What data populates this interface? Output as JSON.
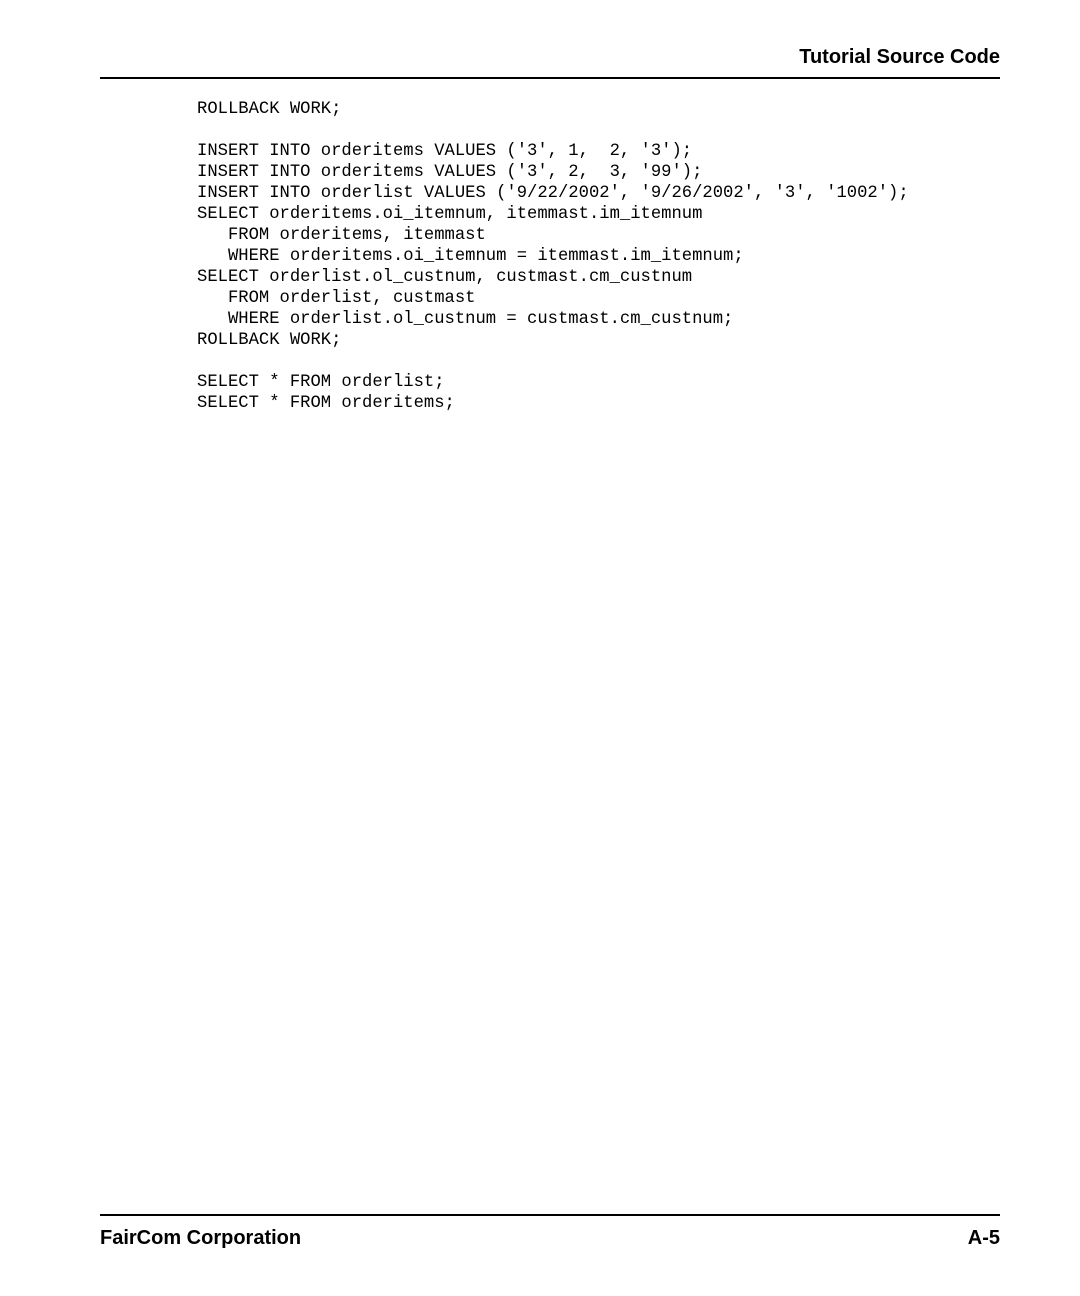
{
  "header": {
    "title": "Tutorial Source Code"
  },
  "code": {
    "text": "ROLLBACK WORK;\n\nINSERT INTO orderitems VALUES ('3', 1,  2, '3');\nINSERT INTO orderitems VALUES ('3', 2,  3, '99');\nINSERT INTO orderlist VALUES ('9/22/2002', '9/26/2002', '3', '1002');\nSELECT orderitems.oi_itemnum, itemmast.im_itemnum\n   FROM orderitems, itemmast\n   WHERE orderitems.oi_itemnum = itemmast.im_itemnum;\nSELECT orderlist.ol_custnum, custmast.cm_custnum\n   FROM orderlist, custmast\n   WHERE orderlist.ol_custnum = custmast.cm_custnum;\nROLLBACK WORK;\n\nSELECT * FROM orderlist;\nSELECT * FROM orderitems;"
  },
  "footer": {
    "left": "FairCom Corporation",
    "right": "A-5"
  }
}
